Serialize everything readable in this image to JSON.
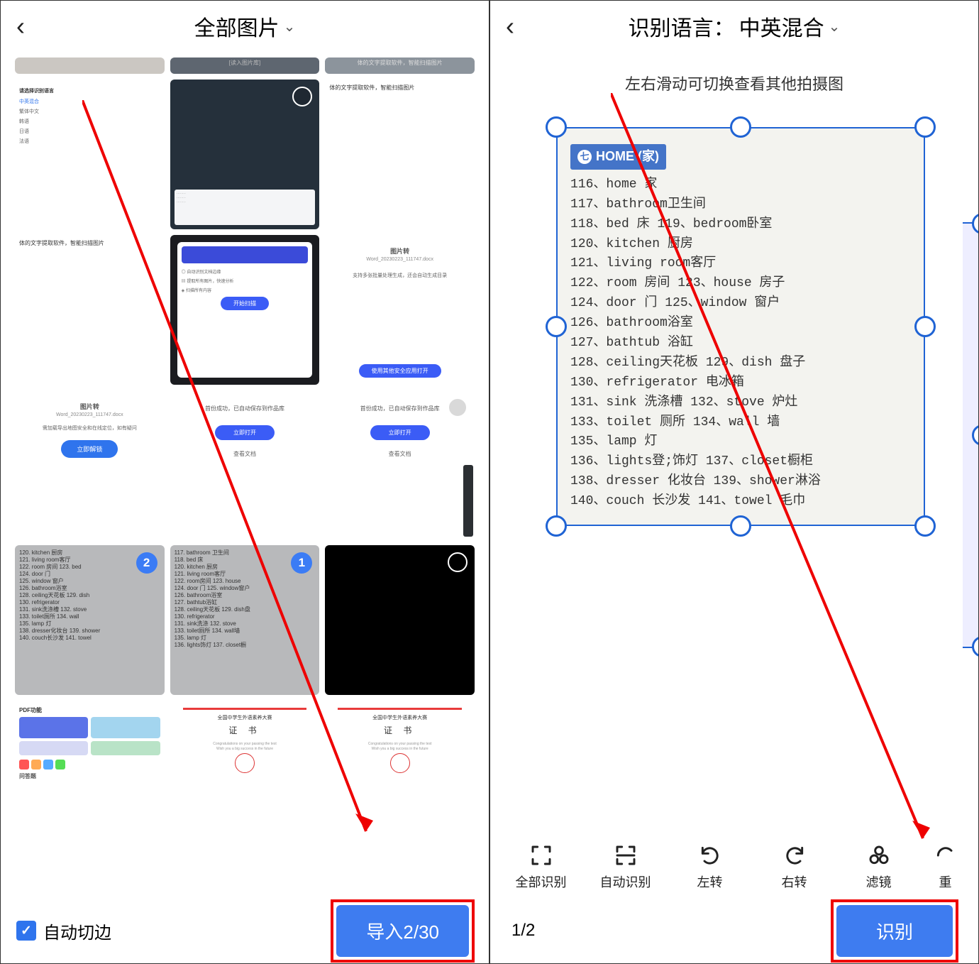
{
  "left": {
    "title": "全部图片",
    "auto_crop_label": "自动切边",
    "import_label": "导入2/30",
    "thumbs": {
      "topbar0": "[读入图片库]",
      "topbar1": "体的文字提取软件，智能扫描图片",
      "lang_items": [
        "请选择识别语言",
        "中英混合",
        "繁体中文",
        "韩语",
        "日语",
        "法语"
      ],
      "t3": "体的文字提取软件，智能扫描图片",
      "t4_items": [
        "自动识别文档边缘",
        "提取所有图片，快速分析",
        "扫描所有内容"
      ],
      "t4_btn": "开始扫描",
      "t5_title": "图片转",
      "t5_sub": "Word_20230223_111747.docx",
      "t5_desc": "支持多张批量处理生成，还会自动生成目录",
      "t5_btn": "使用其他安全应用打开",
      "t6_title": "图片转",
      "t6_sub": "Word_20230223_111747.docx",
      "t6_desc": "需加载导出地图安全和在线定位，如有疑问",
      "t6_btn": "立即解锁",
      "t7_head": "首份成功，已自动保存到作品库",
      "t7_btn": "立即打开",
      "t7_link": "查看文档",
      "cert_head": "全国中学生外语素养大赛",
      "cert_word": "证 书"
    },
    "badge1": "1",
    "badge2": "2"
  },
  "right": {
    "title_prefix": "识别语言：",
    "title_lang": "中英混合",
    "hint": "左右滑动可切换查看其他拍摄图",
    "doc_header": "HOME (家)",
    "doc_num": "七",
    "doc_lines": [
      "116、home 家",
      "117、bathroom卫生间",
      "118、bed 床        119、bedroom卧室",
      "120、kitchen 厨房",
      "121、living room客厅",
      "122、room 房间      123、house 房子",
      "124、door 门        125、window 窗户",
      "126、bathroom浴室",
      "127、bathtub 浴缸",
      "128、ceiling天花板   129、dish 盘子",
      "130、refrigerator 电冰箱",
      "131、sink 洗涤槽     132、stove 炉灶",
      "133、toilet 厕所     134、wall 墙",
      "135、lamp 灯",
      "136、lights登;饰灯   137、closet橱柜",
      "138、dresser 化妆台  139、shower淋浴",
      "140、couch 长沙发    141、towel 毛巾"
    ],
    "tools": {
      "full": "全部识别",
      "auto": "自动识别",
      "left": "左转",
      "right": "右转",
      "filter": "滤镜",
      "retake": "重"
    },
    "page": "1/2",
    "recognize": "识别"
  }
}
